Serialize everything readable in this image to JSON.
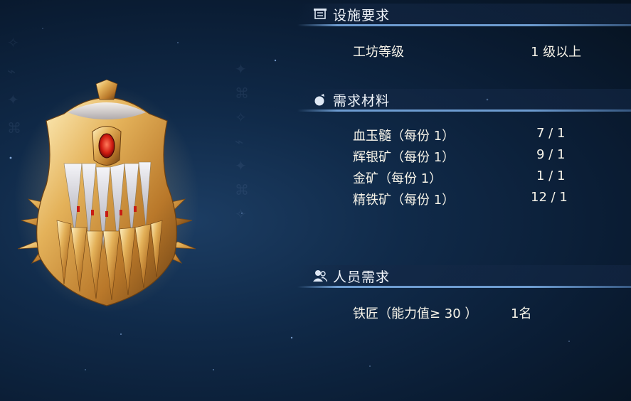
{
  "sections": {
    "facility": {
      "title": "设施要求",
      "icon": "scroll-icon",
      "rows": [
        {
          "label": "工坊等级",
          "value": "1 级以上"
        }
      ]
    },
    "materials": {
      "title": "需求材料",
      "icon": "materials-bag-icon",
      "rows": [
        {
          "label": "血玉髓（每份 1）",
          "value": "7 / 1"
        },
        {
          "label": "辉银矿（每份 1）",
          "value": "9 / 1"
        },
        {
          "label": "金矿（每份 1）",
          "value": "1 / 1"
        },
        {
          "label": "精铁矿（每份 1）",
          "value": "12 / 1"
        }
      ]
    },
    "personnel": {
      "title": "人员需求",
      "icon": "people-icon",
      "rows": [
        {
          "label": "铁匠（能力值≥ 30 ）",
          "value": "1名"
        }
      ]
    }
  },
  "colors": {
    "accent_line": "#78aae1",
    "text": "#f6f3e8",
    "background": "#0a1c33"
  }
}
